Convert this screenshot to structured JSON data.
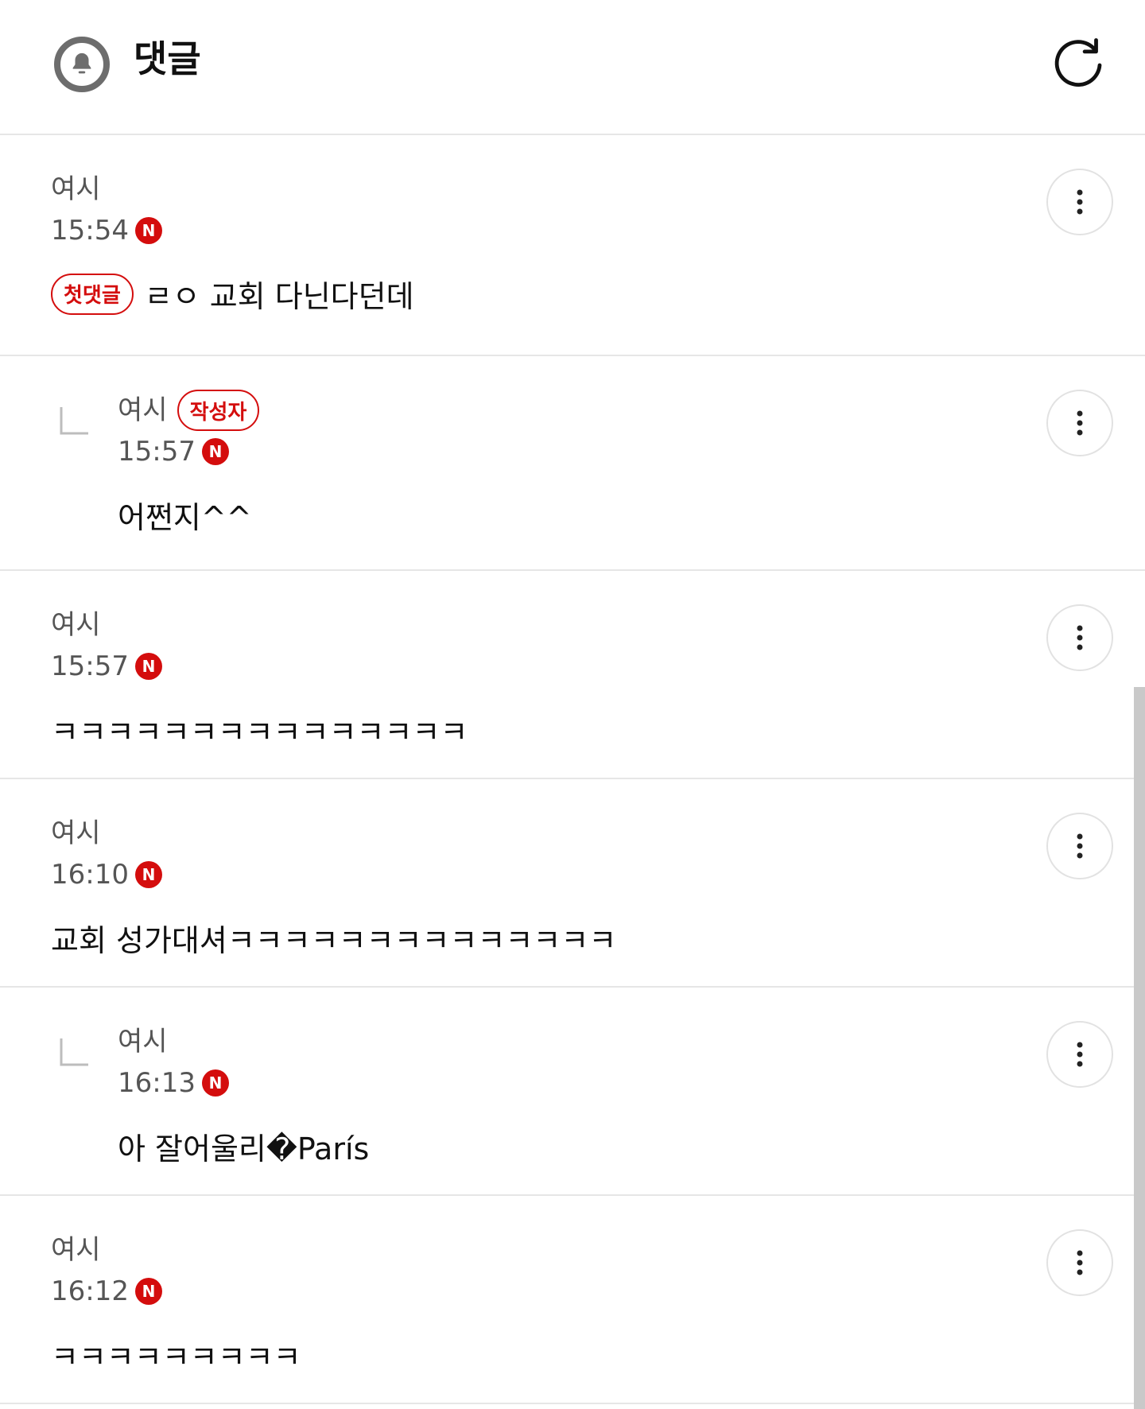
{
  "header": {
    "title": "댓글",
    "bell_icon": "bell-icon",
    "refresh_icon": "refresh-icon"
  },
  "comments": [
    {
      "author": "여시",
      "time": "15:54",
      "new_badge": "N",
      "first_badge": "첫댓글",
      "text": "ㄹㅇ 교회 다닌다던데"
    },
    {
      "author": "여시",
      "author_badge": "작성자",
      "time": "15:57",
      "new_badge": "N",
      "text": "어쩐지^^"
    },
    {
      "author": "여시",
      "time": "15:57",
      "new_badge": "N",
      "text": "ㅋㅋㅋㅋㅋㅋㅋㅋㅋㅋㅋㅋㅋㅋㅋ"
    },
    {
      "author": "여시",
      "time": "16:10",
      "new_badge": "N",
      "text": "교회 성가대셔ㅋㅋㅋㅋㅋㅋㅋㅋㅋㅋㅋㅋㅋㅋ"
    },
    {
      "author": "여시",
      "time": "16:13",
      "new_badge": "N",
      "text": "아 잘어울리�París"
    },
    {
      "author": "여시",
      "time": "16:12",
      "new_badge": "N",
      "text": "ㅋㅋㅋㅋㅋㅋㅋㅋㅋ"
    }
  ],
  "colors": {
    "accent": "#d40d0d",
    "text": "#111111",
    "muted": "#555555",
    "divider": "#e6e6e6"
  }
}
